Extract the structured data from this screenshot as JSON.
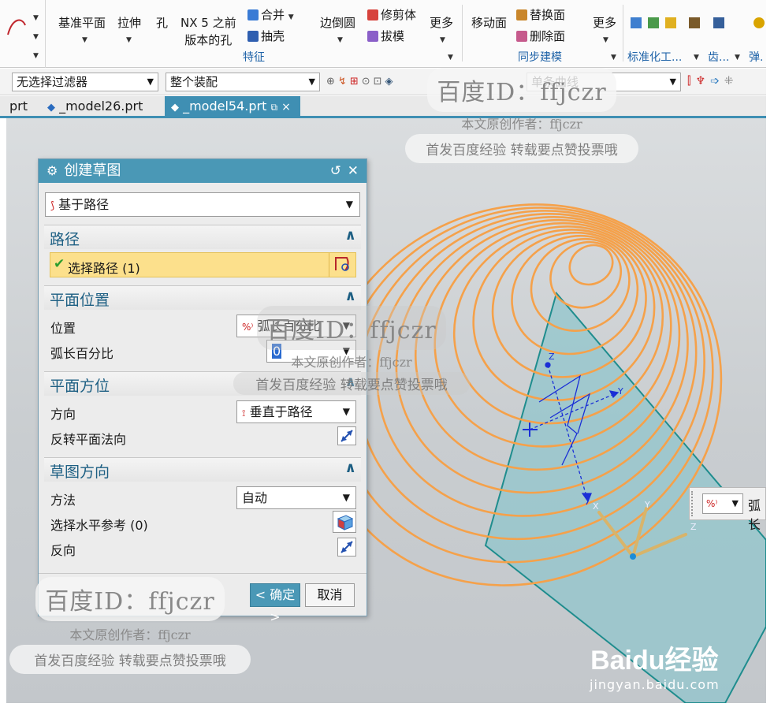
{
  "ribbon": {
    "datum_plane": "基准平面",
    "extrude": "拉伸",
    "hole": "孔",
    "nx5_hole_line1": "NX 5 之前",
    "nx5_hole_line2": "版本的孔",
    "unite": "合并",
    "shell": "抽壳",
    "edge_blend": "边倒圆",
    "trim_body": "修剪体",
    "draft": "拔模",
    "more": "更多",
    "feature_group": "特征",
    "move_face": "移动面",
    "replace_face": "替换面",
    "delete_face": "删除面",
    "more2": "更多",
    "sync_group": "同步建模",
    "standard_group": "标准化工...",
    "gear_group": "齿...",
    "spring_group": "弹."
  },
  "selbar": {
    "filter": "无选择过滤器",
    "scope": "整个装配",
    "curve_rule": "单条曲线"
  },
  "tabs": [
    {
      "label": "prt"
    },
    {
      "label": "_model26.prt"
    },
    {
      "label": "_model54.prt"
    }
  ],
  "dialog": {
    "title": "创建草图",
    "type": "基于路径",
    "path_section": "路径",
    "select_path": "选择路径 (1)",
    "plane_location_section": "平面位置",
    "location_label": "位置",
    "location_value": "弧长百分比",
    "arc_percent_label": "弧长百分比",
    "arc_percent_value": "0",
    "plane_orientation_section": "平面方位",
    "direction_label": "方向",
    "direction_value": "垂直于路径",
    "reverse_normal_label": "反转平面法向",
    "sketch_orientation_section": "草图方向",
    "method_label": "方法",
    "method_value": "自动",
    "select_horizontal_ref": "选择水平参考 (0)",
    "reverse_label": "反向",
    "ok": "< 确定 >",
    "cancel": "取消"
  },
  "floatbar": {
    "value": "弧长"
  },
  "scene": {
    "axis_labels": {
      "z1": "Z",
      "y1": "Y",
      "x2": "X",
      "y2": "Y",
      "z2": "Z"
    }
  },
  "watermark": {
    "id_prefix": "百度ID：",
    "id_name": "ffjczr",
    "author": "本文原创作者：ffjczr",
    "slogan": "首发百度经验 转载要点赞投票哦",
    "baidu_logo": "Baidu经验",
    "baidu_url": "jingyan.baidu.com"
  },
  "colors": {
    "accent": "#4a98b6",
    "helix": "#f5a14a",
    "plane": "#8fc5cc",
    "axis_blue": "#1a2fd6"
  }
}
